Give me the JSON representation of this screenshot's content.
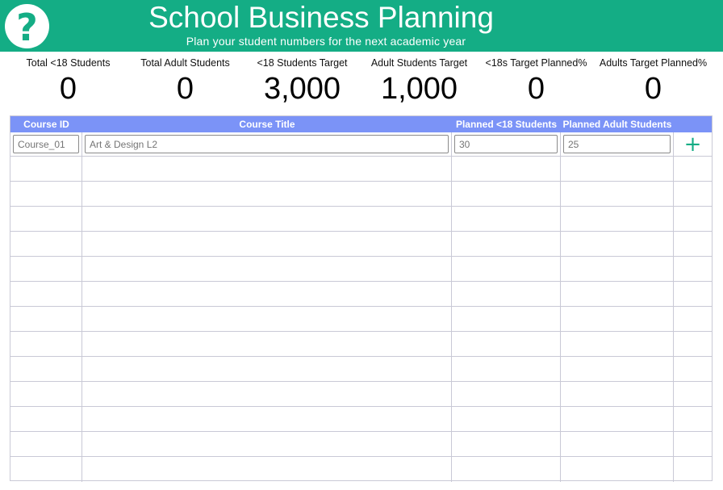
{
  "header": {
    "title": "School Business Planning",
    "subtitle": "Plan your student numbers for the next academic year",
    "help_icon": "?",
    "background_color": "#14ad85"
  },
  "kpis": [
    {
      "label": "Total <18 Students",
      "value": "0"
    },
    {
      "label": "Total Adult Students",
      "value": "0"
    },
    {
      "label": "<18 Students Target",
      "value": "3,000"
    },
    {
      "label": "Adult Students Target",
      "value": "1,000"
    },
    {
      "label": "<18s Target Planned%",
      "value": "0"
    },
    {
      "label": "Adults Target Planned%",
      "value": "0"
    }
  ],
  "table": {
    "header_color": "#7b93f7",
    "columns": [
      "Course ID",
      "Course Title",
      "Planned <18 Students",
      "Planned Adult Students",
      ""
    ],
    "new_row": {
      "course_id_placeholder": "Course_01",
      "course_title_placeholder": "Art & Design L2",
      "planned_u18_placeholder": "30",
      "planned_adult_placeholder": "25",
      "add_icon": "+"
    },
    "empty_rows": 13
  }
}
